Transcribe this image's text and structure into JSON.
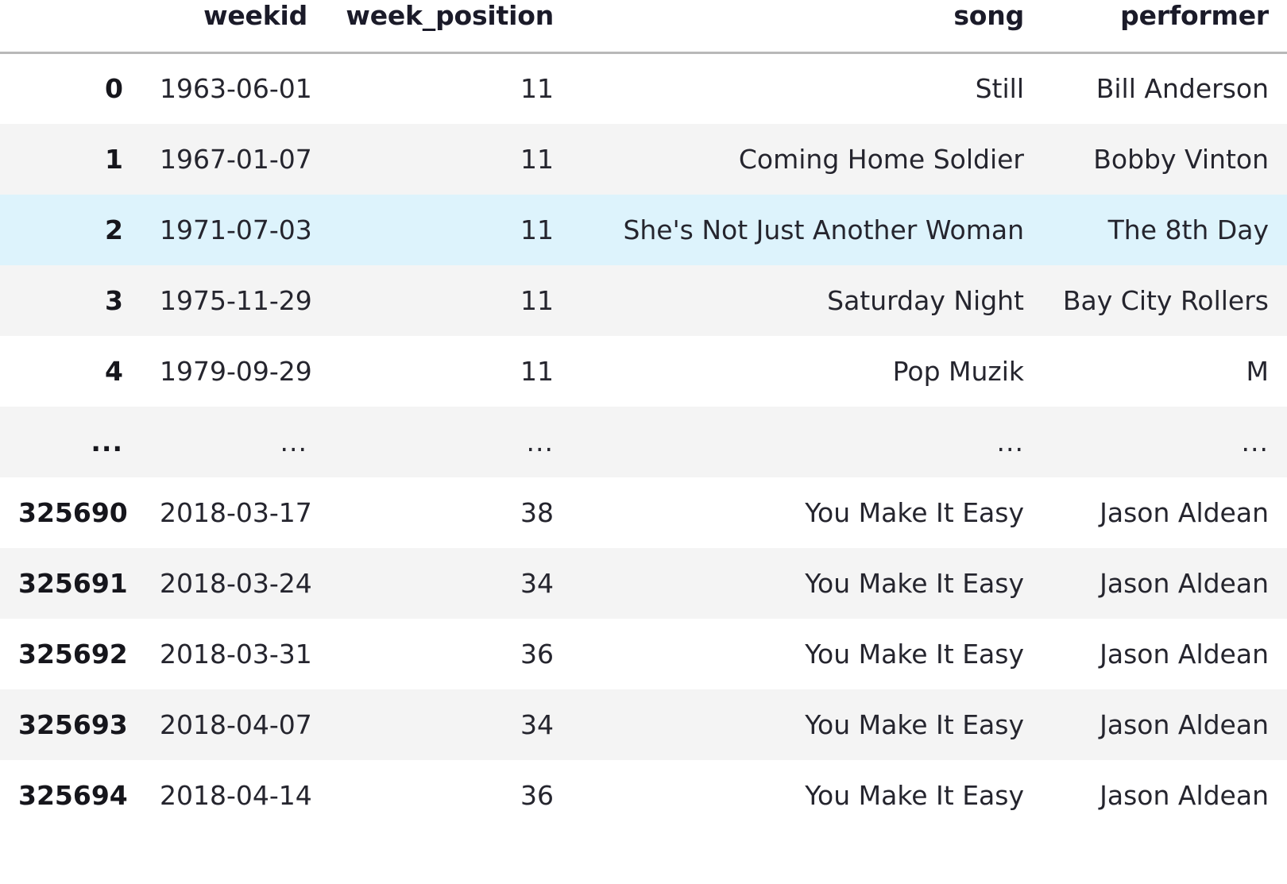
{
  "table": {
    "columns": [
      {
        "key": "index",
        "label": "",
        "align": "right"
      },
      {
        "key": "weekid",
        "label": "weekid",
        "align": "right"
      },
      {
        "key": "week_position",
        "label": "week_position",
        "align": "right"
      },
      {
        "key": "song",
        "label": "song",
        "align": "right"
      },
      {
        "key": "performer",
        "label": "performer",
        "align": "right"
      }
    ],
    "headers": {
      "index": "",
      "weekid": "weekid",
      "week_position": "week_position",
      "song": "song",
      "performer": "performer"
    },
    "rows": [
      {
        "index": "0",
        "weekid": "1963-06-01",
        "week_position": "11",
        "song": "Still",
        "performer": "Bill Anderson",
        "style": "plain"
      },
      {
        "index": "1",
        "weekid": "1967-01-07",
        "week_position": "11",
        "song": "Coming Home Soldier",
        "performer": "Bobby Vinton",
        "style": "stripe"
      },
      {
        "index": "2",
        "weekid": "1971-07-03",
        "week_position": "11",
        "song": "She's Not Just Another Woman",
        "performer": "The 8th Day",
        "style": "highlight"
      },
      {
        "index": "3",
        "weekid": "1975-11-29",
        "week_position": "11",
        "song": "Saturday Night",
        "performer": "Bay City Rollers",
        "style": "stripe"
      },
      {
        "index": "4",
        "weekid": "1979-09-29",
        "week_position": "11",
        "song": "Pop Muzik",
        "performer": "M",
        "style": "plain"
      },
      {
        "index": "...",
        "weekid": "...",
        "week_position": "...",
        "song": "...",
        "performer": "...",
        "style": "stripe",
        "is_ellipsis": true
      },
      {
        "index": "325690",
        "weekid": "2018-03-17",
        "week_position": "38",
        "song": "You Make It Easy",
        "performer": "Jason Aldean",
        "style": "plain"
      },
      {
        "index": "325691",
        "weekid": "2018-03-24",
        "week_position": "34",
        "song": "You Make It Easy",
        "performer": "Jason Aldean",
        "style": "stripe"
      },
      {
        "index": "325692",
        "weekid": "2018-03-31",
        "week_position": "36",
        "song": "You Make It Easy",
        "performer": "Jason Aldean",
        "style": "plain"
      },
      {
        "index": "325693",
        "weekid": "2018-04-07",
        "week_position": "34",
        "song": "You Make It Easy",
        "performer": "Jason Aldean",
        "style": "stripe"
      },
      {
        "index": "325694",
        "weekid": "2018-04-14",
        "week_position": "36",
        "song": "You Make It Easy",
        "performer": "Jason Aldean",
        "style": "plain"
      }
    ]
  },
  "colors": {
    "background": "#ffffff",
    "stripe": "#f4f4f4",
    "highlight": "#ddf3fc",
    "header_rule": "#b8b8b8",
    "text": "#25252e",
    "header_text": "#1b1b29"
  }
}
